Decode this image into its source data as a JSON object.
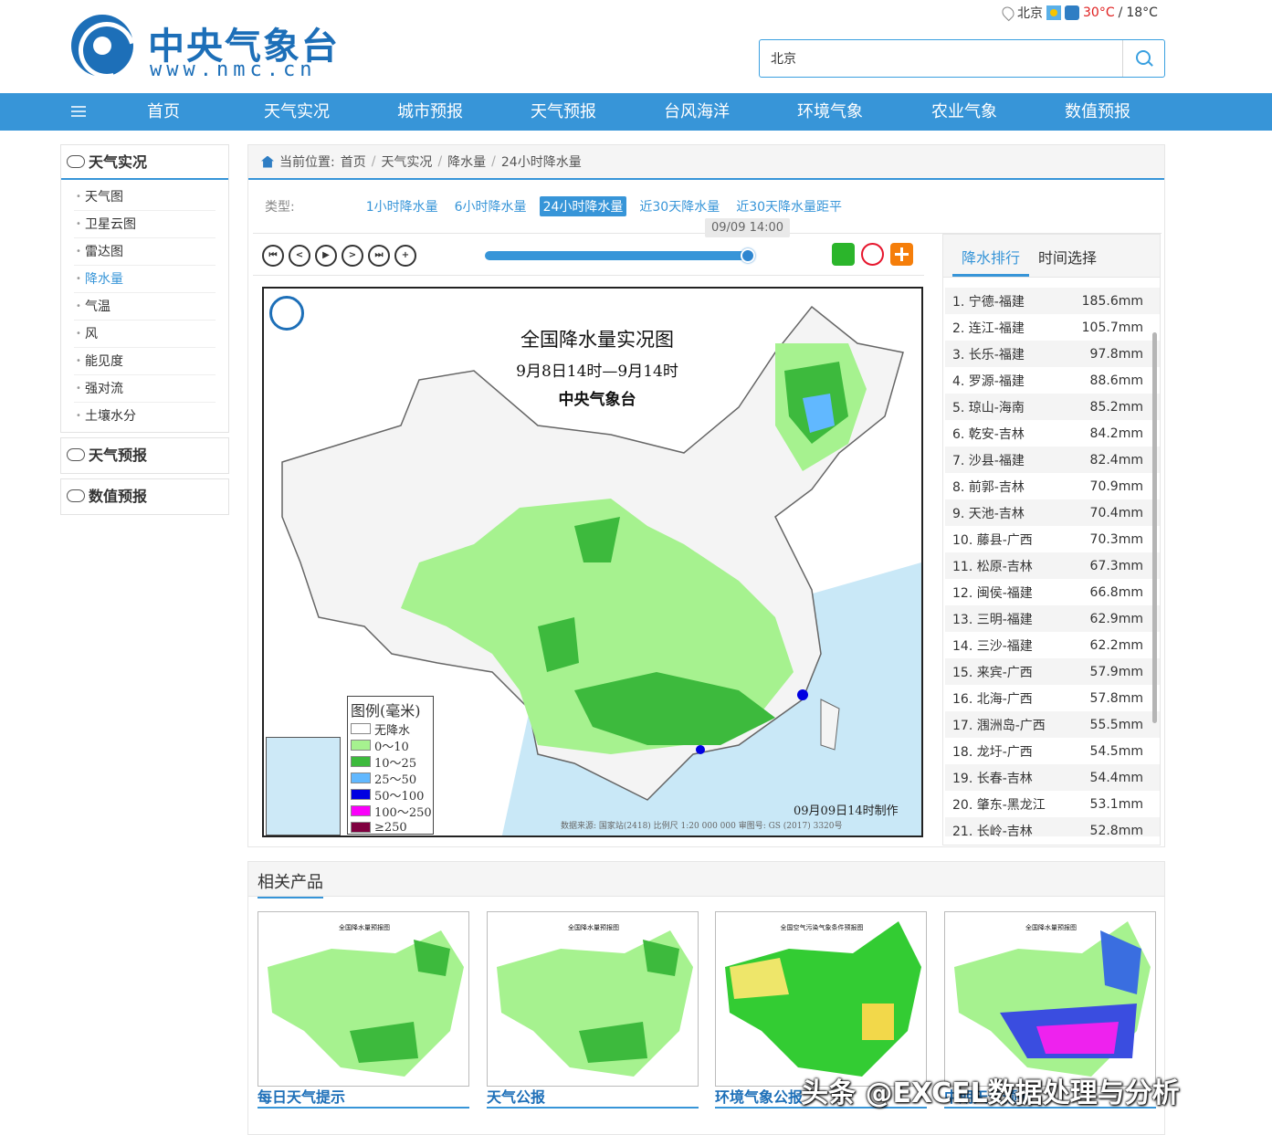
{
  "header": {
    "logo_cn": "中央气象台",
    "logo_en": "www.nmc.cn",
    "weather_city": "北京",
    "temp_high": "30°C",
    "temp_sep": " / ",
    "temp_low": "18°C",
    "search_value": "北京"
  },
  "nav": {
    "items": [
      "首页",
      "天气实况",
      "城市预报",
      "天气预报",
      "台风海洋",
      "环境气象",
      "农业气象",
      "数值预报"
    ]
  },
  "sidebar": {
    "section1": "天气实况",
    "items": [
      "天气图",
      "卫星云图",
      "雷达图",
      "降水量",
      "气温",
      "风",
      "能见度",
      "强对流",
      "土壤水分"
    ],
    "active_item": "降水量",
    "section2": "天气预报",
    "section3": "数值预报"
  },
  "breadcrumb": {
    "prefix": "当前位置:",
    "items": [
      "首页",
      "天气实况",
      "降水量",
      "24小时降水量"
    ]
  },
  "types": {
    "label": "类型:",
    "items": [
      "1小时降水量",
      "6小时降水量",
      "24小时降水量",
      "近30天降水量",
      "近30天降水量距平"
    ],
    "active": "24小时降水量"
  },
  "player": {
    "time_tip": "09/09 14:00",
    "progress": 1.0
  },
  "map": {
    "title": "全国降水量实况图",
    "subtitle": "9月8日14时—9月14时",
    "org": "中央气象台",
    "legend_title": "图例(毫米)",
    "legend": [
      {
        "label": "无降水",
        "color": "#ffffff"
      },
      {
        "label": "0～10",
        "color": "#a6f28f"
      },
      {
        "label": "10～25",
        "color": "#3dba3d"
      },
      {
        "label": "25～50",
        "color": "#61b8ff"
      },
      {
        "label": "50～100",
        "color": "#0000e1"
      },
      {
        "label": "100～250",
        "color": "#fa00fa"
      },
      {
        "label": "≥250",
        "color": "#800040"
      }
    ],
    "made": "09月09日14时制作",
    "source": "数据来源: 国家站(2418) 比例尺 1:20 000 000 审图号: GS (2017) 3320号"
  },
  "ranking": {
    "tab_active": "降水排行",
    "tab_other": "时间选择",
    "rows": [
      {
        "name": "1. 宁德-福建",
        "value": "185.6mm"
      },
      {
        "name": "2. 连江-福建",
        "value": "105.7mm"
      },
      {
        "name": "3. 长乐-福建",
        "value": "97.8mm"
      },
      {
        "name": "4. 罗源-福建",
        "value": "88.6mm"
      },
      {
        "name": "5. 琼山-海南",
        "value": "85.2mm"
      },
      {
        "name": "6. 乾安-吉林",
        "value": "84.2mm"
      },
      {
        "name": "7. 沙县-福建",
        "value": "82.4mm"
      },
      {
        "name": "8. 前郭-吉林",
        "value": "70.9mm"
      },
      {
        "name": "9. 天池-吉林",
        "value": "70.4mm"
      },
      {
        "name": "10. 藤县-广西",
        "value": "70.3mm"
      },
      {
        "name": "11. 松原-吉林",
        "value": "67.3mm"
      },
      {
        "name": "12. 闽侯-福建",
        "value": "66.8mm"
      },
      {
        "name": "13. 三明-福建",
        "value": "62.9mm"
      },
      {
        "name": "14. 三沙-福建",
        "value": "62.2mm"
      },
      {
        "name": "15. 来宾-广西",
        "value": "57.9mm"
      },
      {
        "name": "16. 北海-广西",
        "value": "57.8mm"
      },
      {
        "name": "17. 涠洲岛-广西",
        "value": "55.5mm"
      },
      {
        "name": "18. 龙圩-广西",
        "value": "54.5mm"
      },
      {
        "name": "19. 长春-吉林",
        "value": "54.4mm"
      },
      {
        "name": "20. 肇东-黑龙江",
        "value": "53.1mm"
      },
      {
        "name": "21. 长岭-吉林",
        "value": "52.8mm"
      }
    ]
  },
  "related": {
    "title": "相关产品",
    "cards": [
      {
        "label": "每日天气提示",
        "img_title": "全国降水量预报图"
      },
      {
        "label": "天气公报",
        "img_title": "全国降水量预报图"
      },
      {
        "label": "环境气象公报",
        "img_title": "全国空气污染气象条件预报图"
      },
      {
        "label": "中期天气预报",
        "img_title": "全国降水量预报图"
      }
    ]
  },
  "watermark": "头条 @EXCEL数据处理与分析"
}
